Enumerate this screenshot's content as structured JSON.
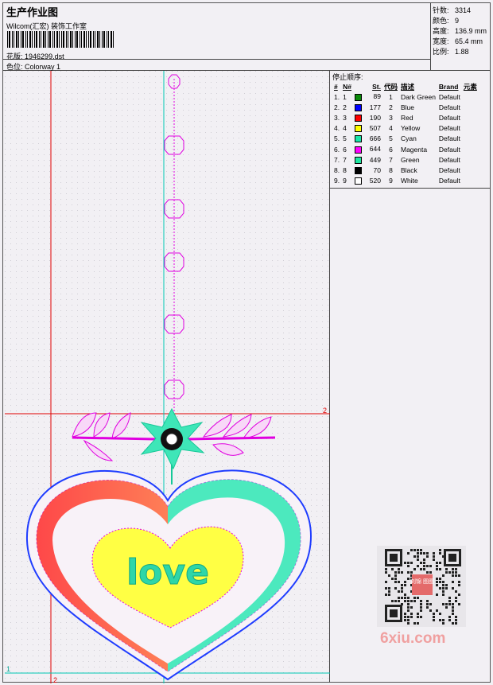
{
  "header": {
    "title": "生产作业图",
    "company": "Wilcom(汇宏) 装饰工作室",
    "design_label": "花版:",
    "design_value": "1946299.dst",
    "colorway_label": "色位:",
    "colorway_value": "Colorway 1"
  },
  "stats": [
    {
      "label": "针数:",
      "value": "3314"
    },
    {
      "label": "颜色:",
      "value": "9"
    },
    {
      "label": "高度:",
      "value": "136.9 mm"
    },
    {
      "label": "宽度:",
      "value": "65.4 mm"
    },
    {
      "label": "比例:",
      "value": "1.88"
    }
  ],
  "stop_sequence": {
    "title": "停止顺序:",
    "columns": [
      "#",
      "N#",
      "St.",
      "代码",
      "描述",
      "Brand",
      "元素"
    ],
    "rows": [
      {
        "n": "1.",
        "num": "1",
        "color": "#0a8a0a",
        "st": "89",
        "code": "1",
        "desc": "Dark Green",
        "brand": "Default"
      },
      {
        "n": "2.",
        "num": "2",
        "color": "#0000ff",
        "st": "177",
        "code": "2",
        "desc": "Blue",
        "brand": "Default"
      },
      {
        "n": "3.",
        "num": "3",
        "color": "#ff0000",
        "st": "190",
        "code": "3",
        "desc": "Red",
        "brand": "Default"
      },
      {
        "n": "4.",
        "num": "4",
        "color": "#ffff00",
        "st": "507",
        "code": "4",
        "desc": "Yellow",
        "brand": "Default"
      },
      {
        "n": "5.",
        "num": "5",
        "color": "#19e6a8",
        "st": "666",
        "code": "5",
        "desc": "Cyan",
        "brand": "Default"
      },
      {
        "n": "6.",
        "num": "6",
        "color": "#ff00ff",
        "st": "644",
        "code": "6",
        "desc": "Magenta",
        "brand": "Default"
      },
      {
        "n": "7.",
        "num": "7",
        "color": "#1ee6a0",
        "st": "449",
        "code": "7",
        "desc": "Green",
        "brand": "Default"
      },
      {
        "n": "8.",
        "num": "8",
        "color": "#000000",
        "st": "70",
        "code": "8",
        "desc": "Black",
        "brand": "Default"
      },
      {
        "n": "9.",
        "num": "9",
        "color": "#ffffff",
        "st": "520",
        "code": "9",
        "desc": "White",
        "brand": "Default"
      }
    ]
  },
  "canvas": {
    "marker_h": "2",
    "marker_v": "2",
    "marker_corner": "1",
    "design_text": "love"
  },
  "watermark": {
    "text": "6xiu.com",
    "qr_label": "刘锦 图图"
  },
  "colors": {
    "guide_red": "#e00000",
    "guide_cyan": "#00c8b4",
    "heart_outline": "#1e3cff",
    "grid_dot": "#d8d6dc"
  }
}
